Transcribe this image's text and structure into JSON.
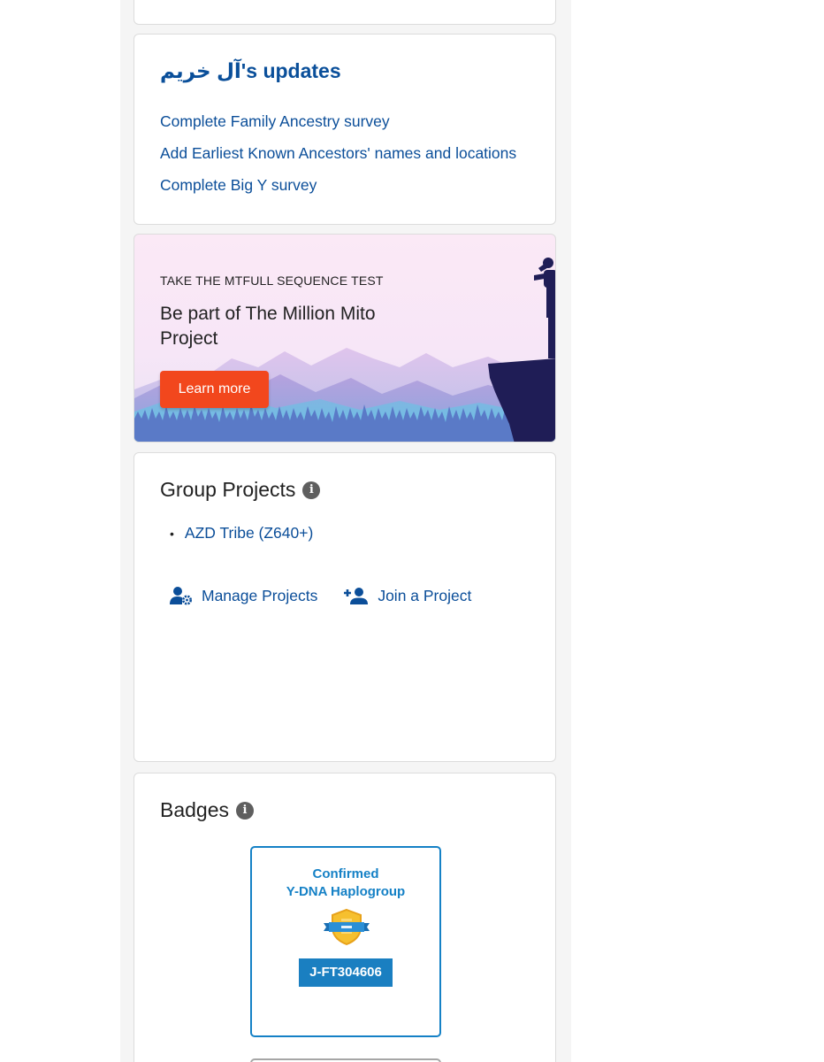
{
  "updates": {
    "name": "آل خريم",
    "suffix": "'s updates",
    "items": [
      "Complete Family Ancestry survey",
      "Add Earliest Known Ancestors' names and locations",
      "Complete Big Y survey"
    ]
  },
  "promo": {
    "eyebrow": "TAKE THE MTFULL SEQUENCE TEST",
    "title": "Be part of The Million Mito Project",
    "button": "Learn more"
  },
  "projects": {
    "title": "Group Projects",
    "info_icon": "info-icon",
    "items": [
      "AZD Tribe (Z640+)"
    ],
    "manage_label": "Manage Projects",
    "manage_icon": "user-gear-icon",
    "join_label": "Join a Project",
    "join_icon": "user-plus-icon"
  },
  "badges": {
    "title": "Badges",
    "info_icon": "info-icon",
    "badge_line1": "Confirmed",
    "badge_line2": "Y-DNA Haplogroup",
    "badge_icon": "shield-ribbon-icon",
    "badge_value": "J-FT304606"
  },
  "colors": {
    "link": "#0b4e99",
    "promo_button": "#f2471d",
    "badge_blue": "#1581c6"
  }
}
